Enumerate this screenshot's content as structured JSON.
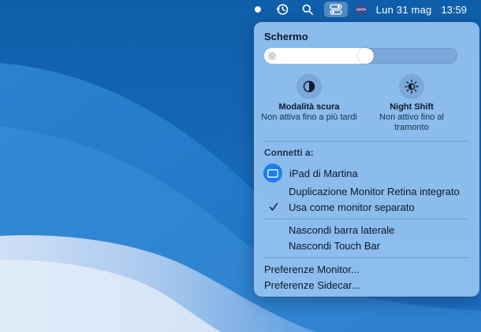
{
  "menubar": {
    "date": "Lun 31 mag",
    "time": "13:59"
  },
  "panel": {
    "title": "Schermo",
    "brightness": 0.53,
    "dark_mode": {
      "label": "Modalità scura",
      "status": "Non attiva fino a più tardi"
    },
    "night_shift": {
      "label": "Night Shift",
      "status_line1": "Non attivo fino al",
      "status_line2": "tramonto"
    },
    "connect_header": "Connetti a:",
    "device_name": "iPad di Martina",
    "mirror_option": "Duplicazione Monitor Retina integrato",
    "separate_option": "Usa come monitor separato",
    "hide_sidebar": "Nascondi barra laterale",
    "hide_touchbar": "Nascondi Touch Bar",
    "monitor_prefs": "Preferenze Monitor...",
    "sidecar_prefs": "Preferenze Sidecar..."
  },
  "colors": {
    "accent": "#1a7ff0",
    "desktop": "#1a6fc2"
  }
}
